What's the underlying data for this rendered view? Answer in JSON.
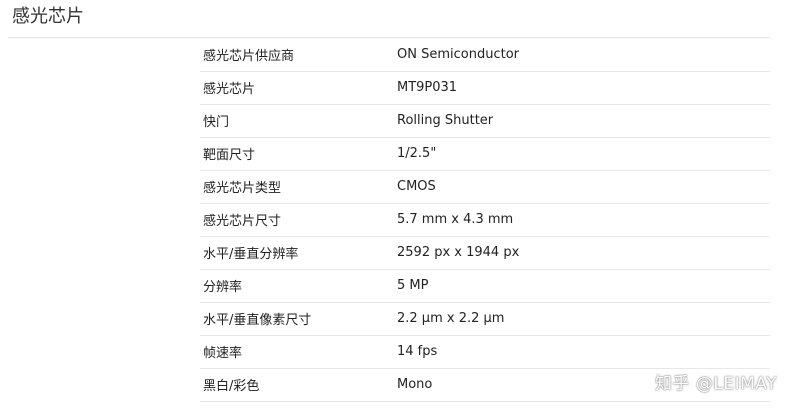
{
  "section": {
    "title": "感光芯片"
  },
  "specs": [
    {
      "label": "感光芯片供应商",
      "value": "ON Semiconductor"
    },
    {
      "label": "感光芯片",
      "value": "MT9P031"
    },
    {
      "label": "快门",
      "value": "Rolling Shutter"
    },
    {
      "label": "靶面尺寸",
      "value": "1/2.5\""
    },
    {
      "label": "感光芯片类型",
      "value": "CMOS"
    },
    {
      "label": "感光芯片尺寸",
      "value": "5.7 mm x 4.3 mm"
    },
    {
      "label": "水平/垂直分辨率",
      "value": "2592 px x 1944 px"
    },
    {
      "label": "分辨率",
      "value": "5 MP"
    },
    {
      "label": "水平/垂直像素尺寸",
      "value": "2.2 µm x 2.2 µm"
    },
    {
      "label": "帧速率",
      "value": "14 fps"
    },
    {
      "label": "黑白/彩色",
      "value": "Mono"
    }
  ],
  "watermark": {
    "text": "知乎 @LEIMAY"
  }
}
